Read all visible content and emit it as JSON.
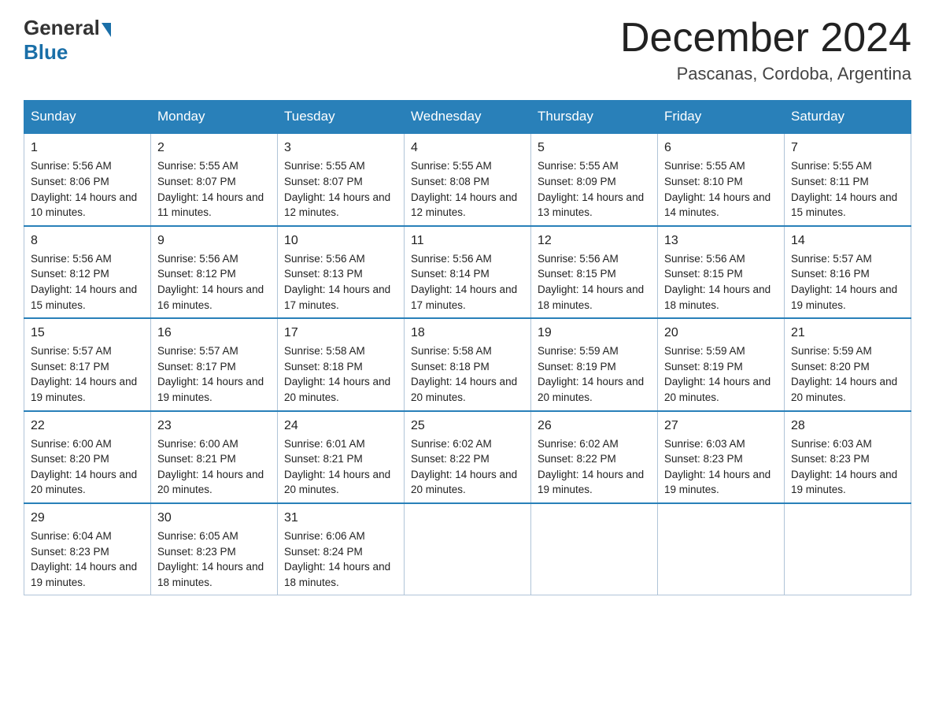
{
  "header": {
    "logo_general": "General",
    "logo_blue": "Blue",
    "month_title": "December 2024",
    "location": "Pascanas, Cordoba, Argentina"
  },
  "weekdays": [
    "Sunday",
    "Monday",
    "Tuesday",
    "Wednesday",
    "Thursday",
    "Friday",
    "Saturday"
  ],
  "weeks": [
    [
      {
        "day": "1",
        "sunrise": "5:56 AM",
        "sunset": "8:06 PM",
        "daylight": "14 hours and 10 minutes."
      },
      {
        "day": "2",
        "sunrise": "5:55 AM",
        "sunset": "8:07 PM",
        "daylight": "14 hours and 11 minutes."
      },
      {
        "day": "3",
        "sunrise": "5:55 AM",
        "sunset": "8:07 PM",
        "daylight": "14 hours and 12 minutes."
      },
      {
        "day": "4",
        "sunrise": "5:55 AM",
        "sunset": "8:08 PM",
        "daylight": "14 hours and 12 minutes."
      },
      {
        "day": "5",
        "sunrise": "5:55 AM",
        "sunset": "8:09 PM",
        "daylight": "14 hours and 13 minutes."
      },
      {
        "day": "6",
        "sunrise": "5:55 AM",
        "sunset": "8:10 PM",
        "daylight": "14 hours and 14 minutes."
      },
      {
        "day": "7",
        "sunrise": "5:55 AM",
        "sunset": "8:11 PM",
        "daylight": "14 hours and 15 minutes."
      }
    ],
    [
      {
        "day": "8",
        "sunrise": "5:56 AM",
        "sunset": "8:12 PM",
        "daylight": "14 hours and 15 minutes."
      },
      {
        "day": "9",
        "sunrise": "5:56 AM",
        "sunset": "8:12 PM",
        "daylight": "14 hours and 16 minutes."
      },
      {
        "day": "10",
        "sunrise": "5:56 AM",
        "sunset": "8:13 PM",
        "daylight": "14 hours and 17 minutes."
      },
      {
        "day": "11",
        "sunrise": "5:56 AM",
        "sunset": "8:14 PM",
        "daylight": "14 hours and 17 minutes."
      },
      {
        "day": "12",
        "sunrise": "5:56 AM",
        "sunset": "8:15 PM",
        "daylight": "14 hours and 18 minutes."
      },
      {
        "day": "13",
        "sunrise": "5:56 AM",
        "sunset": "8:15 PM",
        "daylight": "14 hours and 18 minutes."
      },
      {
        "day": "14",
        "sunrise": "5:57 AM",
        "sunset": "8:16 PM",
        "daylight": "14 hours and 19 minutes."
      }
    ],
    [
      {
        "day": "15",
        "sunrise": "5:57 AM",
        "sunset": "8:17 PM",
        "daylight": "14 hours and 19 minutes."
      },
      {
        "day": "16",
        "sunrise": "5:57 AM",
        "sunset": "8:17 PM",
        "daylight": "14 hours and 19 minutes."
      },
      {
        "day": "17",
        "sunrise": "5:58 AM",
        "sunset": "8:18 PM",
        "daylight": "14 hours and 20 minutes."
      },
      {
        "day": "18",
        "sunrise": "5:58 AM",
        "sunset": "8:18 PM",
        "daylight": "14 hours and 20 minutes."
      },
      {
        "day": "19",
        "sunrise": "5:59 AM",
        "sunset": "8:19 PM",
        "daylight": "14 hours and 20 minutes."
      },
      {
        "day": "20",
        "sunrise": "5:59 AM",
        "sunset": "8:19 PM",
        "daylight": "14 hours and 20 minutes."
      },
      {
        "day": "21",
        "sunrise": "5:59 AM",
        "sunset": "8:20 PM",
        "daylight": "14 hours and 20 minutes."
      }
    ],
    [
      {
        "day": "22",
        "sunrise": "6:00 AM",
        "sunset": "8:20 PM",
        "daylight": "14 hours and 20 minutes."
      },
      {
        "day": "23",
        "sunrise": "6:00 AM",
        "sunset": "8:21 PM",
        "daylight": "14 hours and 20 minutes."
      },
      {
        "day": "24",
        "sunrise": "6:01 AM",
        "sunset": "8:21 PM",
        "daylight": "14 hours and 20 minutes."
      },
      {
        "day": "25",
        "sunrise": "6:02 AM",
        "sunset": "8:22 PM",
        "daylight": "14 hours and 20 minutes."
      },
      {
        "day": "26",
        "sunrise": "6:02 AM",
        "sunset": "8:22 PM",
        "daylight": "14 hours and 19 minutes."
      },
      {
        "day": "27",
        "sunrise": "6:03 AM",
        "sunset": "8:23 PM",
        "daylight": "14 hours and 19 minutes."
      },
      {
        "day": "28",
        "sunrise": "6:03 AM",
        "sunset": "8:23 PM",
        "daylight": "14 hours and 19 minutes."
      }
    ],
    [
      {
        "day": "29",
        "sunrise": "6:04 AM",
        "sunset": "8:23 PM",
        "daylight": "14 hours and 19 minutes."
      },
      {
        "day": "30",
        "sunrise": "6:05 AM",
        "sunset": "8:23 PM",
        "daylight": "14 hours and 18 minutes."
      },
      {
        "day": "31",
        "sunrise": "6:06 AM",
        "sunset": "8:24 PM",
        "daylight": "14 hours and 18 minutes."
      },
      null,
      null,
      null,
      null
    ]
  ]
}
